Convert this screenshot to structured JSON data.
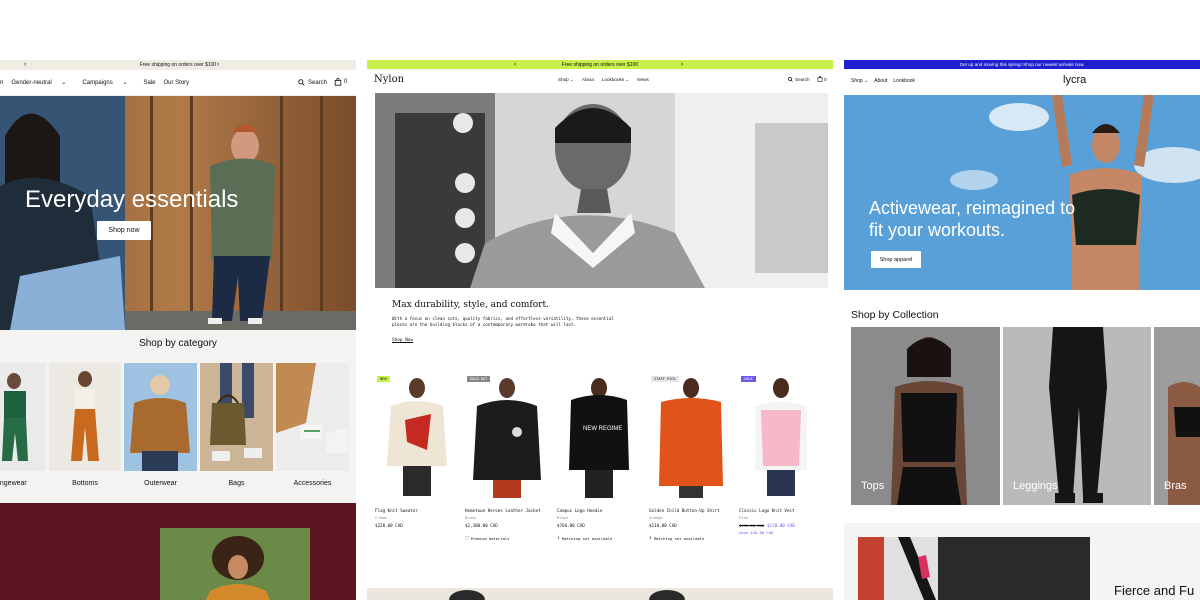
{
  "colors": {
    "sc1_announcement_bg": "#efece4",
    "sc1_burgundy": "#5c1520",
    "sc2_announcement_bg": "#c8f04a",
    "sc2_badge_new": "#c8f04a",
    "sc2_badge_sale": "#6b5cf0",
    "sc3_announcement_bg": "#1f1fd0",
    "sc3_sky": "#5aa0d8",
    "sale_price": "#6b5cf0"
  },
  "sc1": {
    "announcement": "Free shipping on orders over $100",
    "nav_items": [
      "n",
      "Gender-neutral",
      "Campaigns",
      "Sale",
      "Our Story"
    ],
    "search": "Search",
    "cart_count": "0",
    "hero_title": "Everyday essentials",
    "hero_button": "Shop now",
    "section_title": "Shop by category",
    "categories": [
      "ungewear",
      "Bottoms",
      "Outerwear",
      "Bags",
      "Accessories"
    ]
  },
  "sc2": {
    "announcement": "Free shipping on orders over $100",
    "logo": "Nylon",
    "nav_items": [
      "Shop",
      "About",
      "Lookbooks",
      "News"
    ],
    "search": "Search",
    "cart_count": "0",
    "headline": "Max durability, style, and comfort.",
    "body_line1": "With a focus on clean cuts, quality fabrics, and effortless versatility, these essential",
    "body_line2": "pieces are the building blocks of a contemporary wardrobe that will last.",
    "cta": "Shop Now",
    "products": [
      {
        "badge": "NEW",
        "name": "Flag Knit Sweater",
        "color": "Cream",
        "price": "$220.00 CAD",
        "compare": "",
        "save": "",
        "note": ""
      },
      {
        "badge": "SOLD OUT",
        "name": "Hometown Heroes Leather Jacket",
        "color": "Black",
        "price": "$2,300.00 CAD",
        "compare": "",
        "save": "",
        "note": "Premium materials"
      },
      {
        "badge": "",
        "name": "Campus Logo Hoodie",
        "color": "Black",
        "price": "$760.00 CAD",
        "compare": "",
        "save": "",
        "note": "Matching set available"
      },
      {
        "badge": "STAFF PICK",
        "name": "Golden Child Button-Up Shirt",
        "color": "Orange",
        "price": "$210.00 CAD",
        "compare": "",
        "save": "",
        "note": "Matching set available"
      },
      {
        "badge": "SALE",
        "name": "Classic Logo Knit Vest",
        "color": "Pink",
        "price": "$170.00 CAD",
        "compare": "$190.00 CAD",
        "save": "Save $20.00 CAD",
        "note": ""
      }
    ]
  },
  "sc3": {
    "announcement": "Get up and moving this spring! Shop our newest arrivals now.",
    "nav_items": [
      "Shop",
      "About",
      "Lookbook"
    ],
    "logo": "lycra",
    "hero_line1": "Activewear, reimagined to",
    "hero_line2": "fit your workouts.",
    "hero_button": "Shop apparel",
    "section_title": "Shop by Collection",
    "collections": [
      "Tops",
      "Leggings",
      "Bras"
    ],
    "promo_title": "Fierce and Fu"
  }
}
